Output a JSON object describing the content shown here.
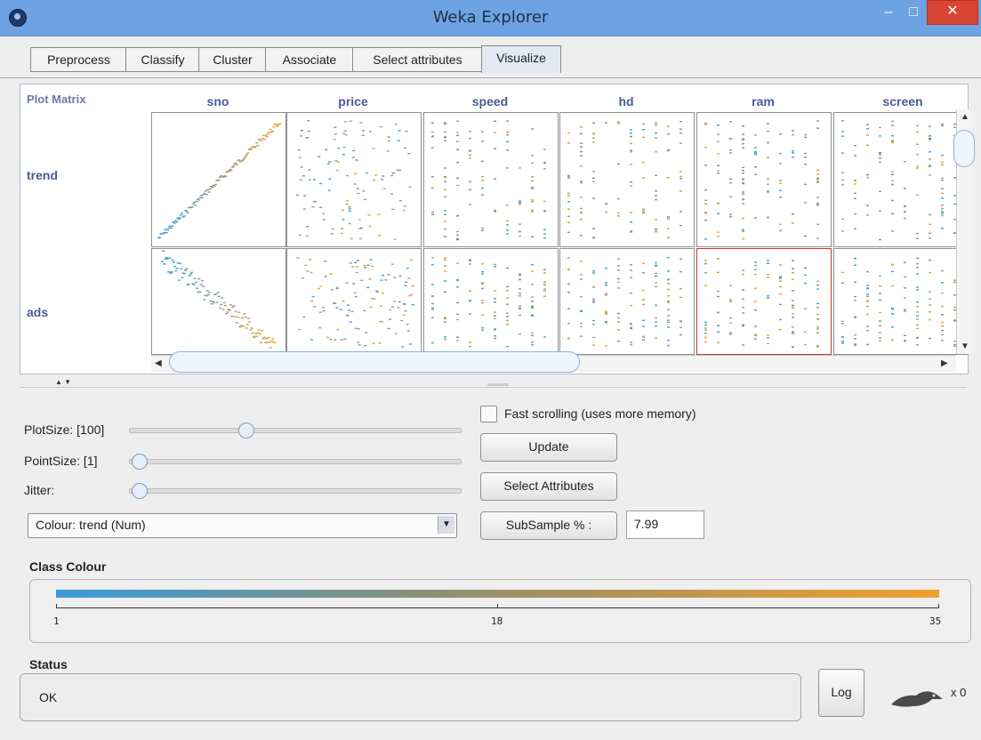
{
  "window": {
    "title": "Weka Explorer"
  },
  "tabs": [
    {
      "label": "Preprocess",
      "selected": false
    },
    {
      "label": "Classify",
      "selected": false
    },
    {
      "label": "Cluster",
      "selected": false
    },
    {
      "label": "Associate",
      "selected": false
    },
    {
      "label": "Select attributes",
      "selected": false
    },
    {
      "label": "Visualize",
      "selected": true
    }
  ],
  "plot_matrix": {
    "label": "Plot Matrix",
    "columns": [
      "sno",
      "price",
      "speed",
      "hd",
      "ram",
      "screen"
    ],
    "rows": [
      "trend",
      "ads"
    ]
  },
  "controls": {
    "plot_size_label": "PlotSize: [100]",
    "point_size_label": "PointSize: [1]",
    "jitter_label": "Jitter:",
    "plot_size_level": 0.34,
    "point_size_level": 0.0,
    "jitter_level": 0.0,
    "colour_select": "Colour: trend  (Num)",
    "fast_scrolling_label": "Fast scrolling (uses more memory)",
    "fast_scrolling_checked": false,
    "update_button": "Update",
    "select_attributes_button": "Select Attributes",
    "subsample_button": "SubSample % :",
    "subsample_value": "7.99"
  },
  "class_colour": {
    "label": "Class Colour",
    "min": "1",
    "mid": "18",
    "max": "35",
    "gradient_colors": [
      "#3a9bd9",
      "#f0a030"
    ]
  },
  "status": {
    "label": "Status",
    "text": "OK",
    "log_button": "Log",
    "count": "x 0"
  }
}
